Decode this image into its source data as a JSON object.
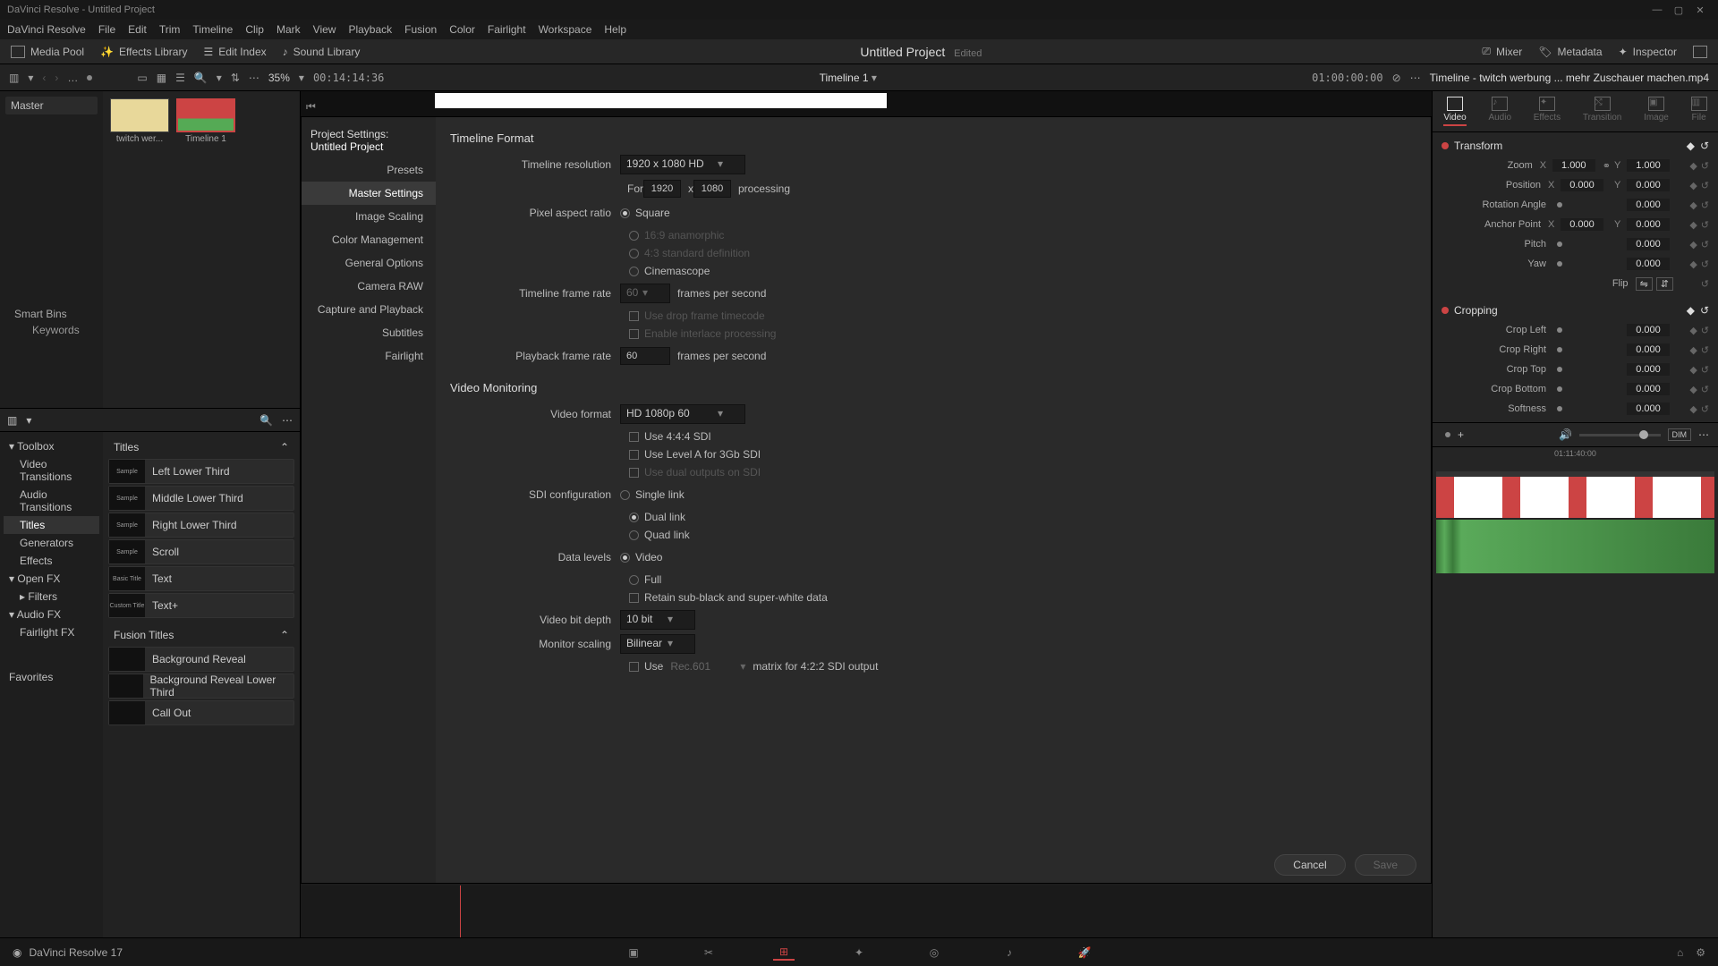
{
  "title_bar": {
    "app": "DaVinci Resolve",
    "project": "Untitled Project"
  },
  "menu": [
    "DaVinci Resolve",
    "File",
    "Edit",
    "Trim",
    "Timeline",
    "Clip",
    "Mark",
    "View",
    "Playback",
    "Fusion",
    "Color",
    "Fairlight",
    "Workspace",
    "Help"
  ],
  "top_toolbar": {
    "media_pool": "Media Pool",
    "effects_library": "Effects Library",
    "edit_index": "Edit Index",
    "sound_library": "Sound Library",
    "project_title": "Untitled Project",
    "edited": "Edited",
    "mixer": "Mixer",
    "metadata": "Metadata",
    "inspector": "Inspector"
  },
  "sub_toolbar": {
    "zoom_pct": "35%",
    "timecode": "00:14:14:36",
    "timeline_name": "Timeline 1",
    "out_tc": "01:00:00:00",
    "right_label": "Timeline - twitch werbung ... mehr Zuschauer machen.mp4"
  },
  "media_pool": {
    "master": "Master",
    "clips": [
      {
        "name": "twitch wer..."
      },
      {
        "name": "Timeline 1"
      }
    ],
    "smart_bins": "Smart Bins",
    "keywords": "Keywords"
  },
  "fx_tree": {
    "toolbox": "Toolbox",
    "items": [
      "Video Transitions",
      "Audio Transitions",
      "Titles",
      "Generators",
      "Effects"
    ],
    "open_fx": "Open FX",
    "filters": "Filters",
    "audio_fx": "Audio FX",
    "fairlight_fx": "Fairlight FX",
    "favorites": "Favorites"
  },
  "fx_list": {
    "titles_hdr": "Titles",
    "titles": [
      "Left Lower Third",
      "Middle Lower Third",
      "Right Lower Third",
      "Scroll",
      "Text",
      "Text+"
    ],
    "fusion_hdr": "Fusion Titles",
    "fusion": [
      "Background Reveal",
      "Background Reveal Lower Third",
      "Call Out"
    ]
  },
  "dialog": {
    "title": "Project Settings:",
    "project": "Untitled Project",
    "categories": [
      "Presets",
      "Master Settings",
      "Image Scaling",
      "Color Management",
      "General Options",
      "Camera RAW",
      "Capture and Playback",
      "Subtitles",
      "Fairlight"
    ],
    "timeline_format": {
      "hdr": "Timeline Format",
      "resolution_lbl": "Timeline resolution",
      "resolution": "1920 x 1080 HD",
      "for": "For",
      "w": "1920",
      "h": "1080",
      "x": "x",
      "processing": "processing",
      "par_lbl": "Pixel aspect ratio",
      "par_square": "Square",
      "par_169": "16:9 anamorphic",
      "par_43": "4:3 standard definition",
      "par_cine": "Cinemascope",
      "fr_lbl": "Timeline frame rate",
      "fr": "60",
      "fps": "frames per second",
      "drop": "Use drop frame timecode",
      "interlace": "Enable interlace processing",
      "pfr_lbl": "Playback frame rate",
      "pfr": "60"
    },
    "video_monitoring": {
      "hdr": "Video Monitoring",
      "vf_lbl": "Video format",
      "vf": "HD 1080p 60",
      "use444": "Use 4:4:4 SDI",
      "levelA": "Use Level A for 3Gb SDI",
      "dual": "Use dual outputs on SDI",
      "sdi_lbl": "SDI configuration",
      "sdi_single": "Single link",
      "sdi_dual": "Dual link",
      "sdi_quad": "Quad link",
      "dl_lbl": "Data levels",
      "dl_video": "Video",
      "dl_full": "Full",
      "retain": "Retain sub-black and super-white data",
      "vbd_lbl": "Video bit depth",
      "vbd": "10 bit",
      "ms_lbl": "Monitor scaling",
      "ms": "Bilinear",
      "use": "Use",
      "rec": "Rec.601",
      "matrix": "matrix for 4:2:2 SDI output"
    },
    "cancel": "Cancel",
    "save": "Save"
  },
  "inspector": {
    "tabs": [
      "Video",
      "Audio",
      "Effects",
      "Transition",
      "Image",
      "File"
    ],
    "transform": {
      "hdr": "Transform",
      "zoom": "Zoom",
      "zoom_x": "1.000",
      "zoom_y": "1.000",
      "position": "Position",
      "pos_x": "0.000",
      "pos_y": "0.000",
      "rot": "Rotation Angle",
      "rot_v": "0.000",
      "anchor": "Anchor Point",
      "anc_x": "0.000",
      "anc_y": "0.000",
      "pitch": "Pitch",
      "pitch_v": "0.000",
      "yaw": "Yaw",
      "yaw_v": "0.000",
      "flip": "Flip"
    },
    "cropping": {
      "hdr": "Cropping",
      "left": "Crop Left",
      "left_v": "0.000",
      "right": "Crop Right",
      "right_v": "0.000",
      "top": "Crop Top",
      "top_v": "0.000",
      "bottom": "Crop Bottom",
      "bottom_v": "0.000",
      "soft": "Softness",
      "soft_v": "0.000"
    },
    "tl_tc": "01:11:40:00",
    "dim": "DIM"
  },
  "status": {
    "version": "DaVinci Resolve 17"
  }
}
